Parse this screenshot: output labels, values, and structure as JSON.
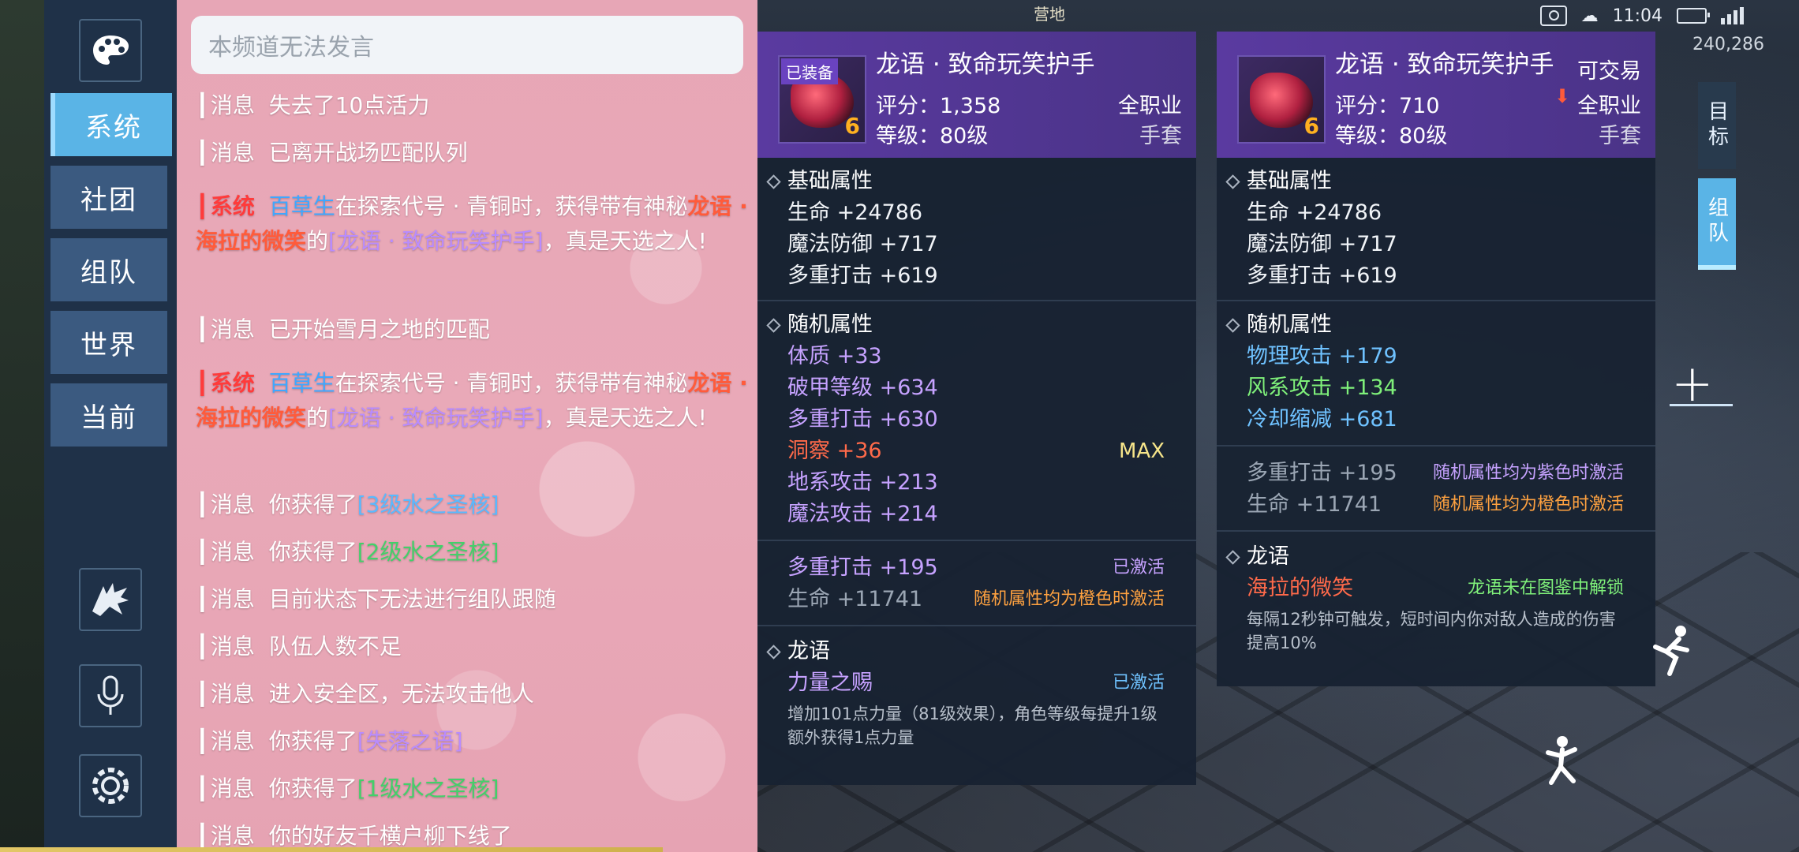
{
  "status": {
    "time": "11:04",
    "coords": "240,286",
    "camp_label": "营地"
  },
  "rail": {
    "tabs": [
      "系统",
      "社团",
      "组队",
      "世界",
      "当前"
    ],
    "active_tab": "系统"
  },
  "chat": {
    "input_placeholder": "本频道无法发言",
    "messages": [
      {
        "tag": "消息",
        "text": "失去了10点活力"
      },
      {
        "tag": "消息",
        "text": "已离开战场匹配队列"
      },
      {
        "tag": "系统",
        "player": "百草生",
        "pre": "在探索代号 · 青铜时，获得带有神秘",
        "dragon": "龙语 · 海拉的微笑",
        "mid": "的",
        "item": "[龙语 · 致命玩笑护手]",
        "post": "，真是天选之人!"
      },
      {
        "tag": "消息",
        "text": "已开始雪月之地的匹配"
      },
      {
        "tag": "系统",
        "player": "百草生",
        "pre": "在探索代号 · 青铜时，获得带有神秘",
        "dragon": "龙语 · 海拉的微笑",
        "mid": "的",
        "item": "[龙语 · 致命玩笑护手]",
        "post": "，真是天选之人!"
      },
      {
        "tag": "消息",
        "pre": "你获得了",
        "item": "[3级水之圣核]"
      },
      {
        "tag": "消息",
        "pre": "你获得了",
        "item": "[2级水之圣核]"
      },
      {
        "tag": "消息",
        "text": "目前状态下无法进行组队跟随"
      },
      {
        "tag": "消息",
        "text": "队伍人数不足"
      },
      {
        "tag": "消息",
        "text": "进入安全区，无法攻击他人"
      },
      {
        "tag": "消息",
        "pre": "你获得了",
        "item": "[失落之语]"
      },
      {
        "tag": "消息",
        "pre": "你获得了",
        "item": "[1级水之圣核]"
      },
      {
        "tag": "消息",
        "text": "你的好友千横户柳下线了"
      }
    ]
  },
  "tip_left": {
    "badge": "已装备",
    "name": "龙语 · 致命玩笑护手",
    "score": "评分：1,358",
    "level": "等级：80级",
    "class": "全职业",
    "slot": "手套",
    "icon_level": "6",
    "base_title": "基础属性",
    "base": [
      "生命 +24786",
      "魔法防御 +717",
      "多重打击 +619"
    ],
    "random_title": "随机属性",
    "random": [
      {
        "text": "体质 +33",
        "color": "purple"
      },
      {
        "text": "破甲等级 +634",
        "color": "purple"
      },
      {
        "text": "多重打击 +630",
        "color": "purple"
      },
      {
        "text": "洞察 +36",
        "color": "red",
        "right": "MAX"
      },
      {
        "text": "地系攻击 +213",
        "color": "purple"
      },
      {
        "text": "魔法攻击 +214",
        "color": "purple"
      }
    ],
    "bonus": [
      {
        "text": "多重打击 +195",
        "color": "purple",
        "right": "已激活",
        "right_color": "purple"
      },
      {
        "text": "生命 +11741",
        "color": "grey",
        "right": "随机属性均为橙色时激活",
        "right_color": "orange"
      }
    ],
    "dragon_title": "龙语",
    "dragon_name": "力量之赐",
    "dragon_status": "已激活",
    "dragon_desc": "增加101点力量（81级效果），角色等级每提升1级额外获得1点力量"
  },
  "tip_right": {
    "name": "龙语 · 致命玩笑护手",
    "tradable": "可交易",
    "score": "评分：710",
    "level": "等级：80级",
    "class": "全职业",
    "slot": "手套",
    "icon_level": "6",
    "base_title": "基础属性",
    "base": [
      "生命 +24786",
      "魔法防御 +717",
      "多重打击 +619"
    ],
    "random_title": "随机属性",
    "random": [
      {
        "text": "物理攻击 +179",
        "color": "blue"
      },
      {
        "text": "风系攻击 +134",
        "color": "green"
      },
      {
        "text": "冷却缩减 +681",
        "color": "blue"
      }
    ],
    "bonus": [
      {
        "text": "多重打击 +195",
        "color": "grey",
        "right": "随机属性均为紫色时激活",
        "right_color": "purple"
      },
      {
        "text": "生命 +11741",
        "color": "grey",
        "right": "随机属性均为橙色时激活",
        "right_color": "orange"
      }
    ],
    "dragon_title": "龙语",
    "dragon_name": "海拉的微笑",
    "dragon_status": "龙语未在图鉴中解锁",
    "dragon_desc": "每隔12秒钟可触发，短时间内你对敌人造成的伤害提高10%"
  },
  "hud": {
    "target_tab": "目标",
    "team_tab": "组队",
    "plus": "+"
  },
  "colors": {
    "rail": "#1f3148",
    "tab": "#3b5a80",
    "tab_active": "#5ab4e6",
    "chat_bg": "#e7a6b6",
    "tip_header": "#5a3aa0"
  }
}
